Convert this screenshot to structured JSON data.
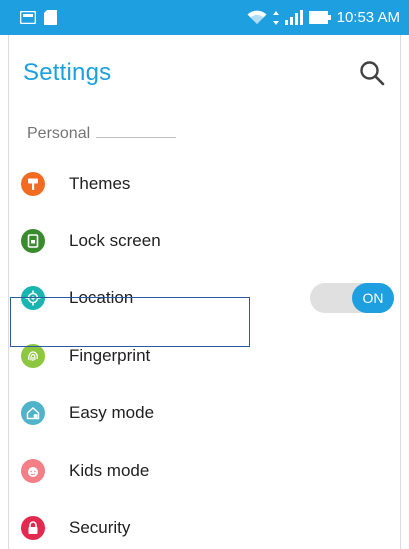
{
  "status_bar": {
    "time": "10:53 AM",
    "color": "#1e9fe0",
    "icons": [
      "gallery-icon",
      "sd-card-icon",
      "wifi-icon",
      "signal-icon",
      "battery-icon"
    ]
  },
  "app_bar": {
    "title": "Settings",
    "search_icon": "search-icon"
  },
  "section": {
    "label": "Personal"
  },
  "items": [
    {
      "label": "Themes",
      "icon": "themes-icon",
      "color": "#f26b21"
    },
    {
      "label": "Lock screen",
      "icon": "lock-screen-icon",
      "color": "#3a8a2e"
    },
    {
      "label": "Location",
      "icon": "location-icon",
      "color": "#19b5b0",
      "toggle": "ON"
    },
    {
      "label": "Fingerprint",
      "icon": "fingerprint-icon",
      "color": "#8dc63f"
    },
    {
      "label": "Easy mode",
      "icon": "easy-mode-icon",
      "color": "#4fb3c9"
    },
    {
      "label": "Kids mode",
      "icon": "kids-mode-icon",
      "color": "#f47f87"
    },
    {
      "label": "Security",
      "icon": "security-icon",
      "color": "#e2294f"
    }
  ],
  "colors": {
    "accent": "#1e9fe0",
    "text": "#212121",
    "section": "#757575",
    "selection": "#2b5aa0"
  }
}
